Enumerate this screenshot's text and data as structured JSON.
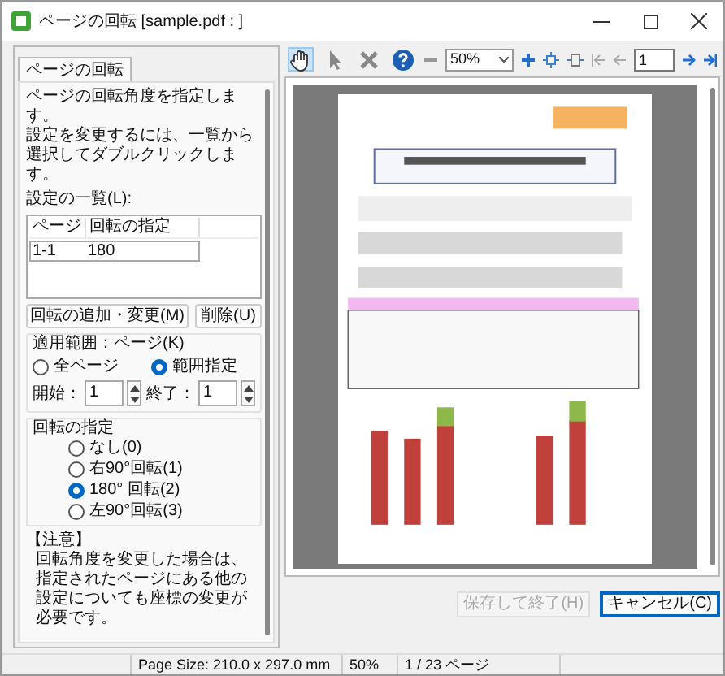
{
  "window": {
    "title": "ページの回転 [sample.pdf : ]"
  },
  "tabs": [
    {
      "label": "ページの回転",
      "selected": true
    }
  ],
  "description": [
    "ページの回転角度を指定します。",
    "設定を変更するには、一覧から選択してダブルクリックします。"
  ],
  "list": {
    "label": "設定の一覧(L):",
    "columns": [
      "ページ",
      "回転の指定"
    ],
    "rows": [
      {
        "cells": [
          "1-1",
          "180"
        ],
        "selected": false
      }
    ]
  },
  "list_buttons": [
    {
      "label": "回転の追加・変更(M)"
    },
    {
      "label": "削除(U)"
    }
  ],
  "range": {
    "label": "適用範囲：ページ(K)",
    "options": [
      {
        "label": "全ページ",
        "selected": false
      },
      {
        "label": "範囲指定",
        "selected": true
      }
    ],
    "start": {
      "label": "開始：",
      "value": "1"
    },
    "end": {
      "label": "終了：",
      "value": "1"
    }
  },
  "rotation": {
    "label": "回転の指定",
    "options": [
      {
        "label": "なし(0)",
        "selected": false
      },
      {
        "label": "右90°回転(1)",
        "selected": false
      },
      {
        "label": "180° 回転(2)",
        "selected": true
      },
      {
        "label": "左90°回転(3)",
        "selected": false
      }
    ]
  },
  "note": {
    "title": "【注意】",
    "text": "回転角度を変更した場合は、指定されたページにある他の設定についても座標の変更が必要です。"
  },
  "toolbar": {
    "tools": [
      {
        "kind": "hand",
        "selected": true
      },
      {
        "kind": "pointer",
        "selected": false
      },
      {
        "kind": "delete",
        "selected": false
      },
      {
        "kind": "help",
        "selected": false
      }
    ],
    "zoom": "50%",
    "page": "1"
  },
  "preview": {
    "kind": "picture"
  },
  "buttons": [
    {
      "label": "保存して終了(H)",
      "disabled": true
    },
    {
      "label": "キャンセル(C)",
      "disabled": false
    }
  ],
  "status_bar": [
    "Page Size: 210.0 x 297.0 mm",
    "50%",
    "1 / 23 ページ"
  ]
}
